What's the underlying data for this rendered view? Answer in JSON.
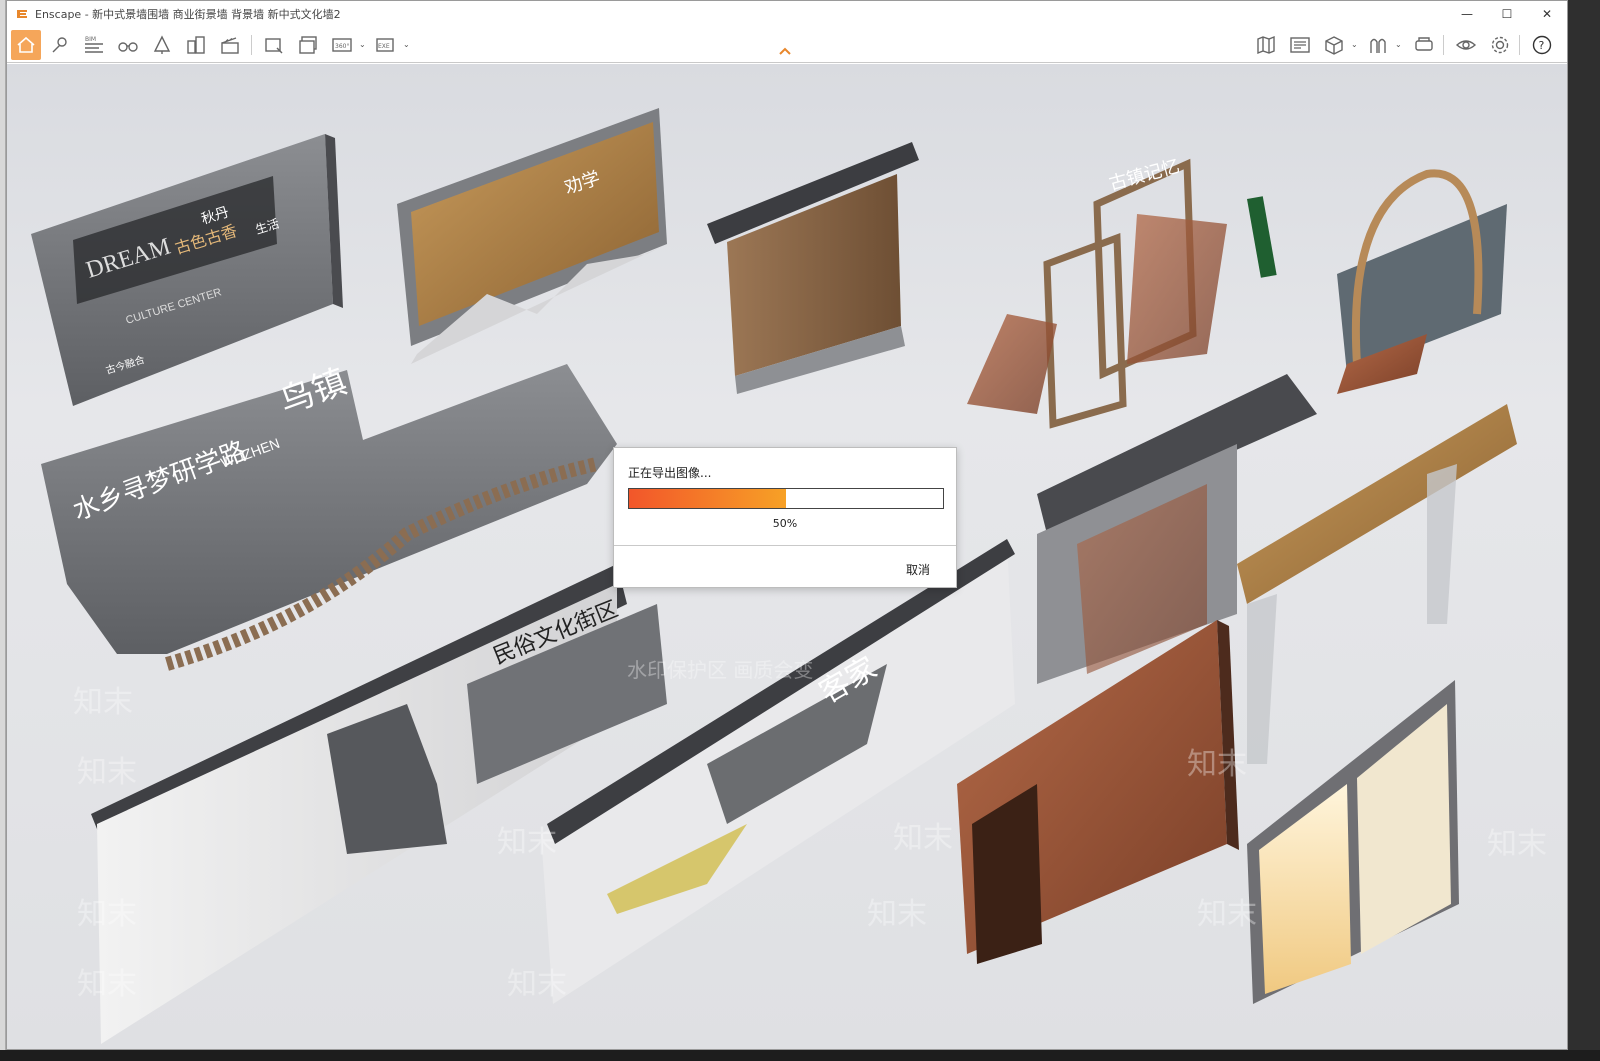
{
  "window": {
    "title": "Enscape - 新中式景墙围墙 商业街景墙 背景墙 新中式文化墙2",
    "controls": {
      "minimize": "—",
      "maximize": "☐",
      "close": "✕"
    }
  },
  "toolbar": {
    "left_tools": [
      "home-icon",
      "location-pin-icon",
      "bim-icon",
      "binoculars-icon",
      "tree-icon",
      "buildings-icon",
      "clapperboard-icon"
    ],
    "export_tools": [
      "screenshot-icon",
      "batch-render-icon",
      "panorama-icon",
      "exe-export-icon"
    ],
    "bim_label": "BIM",
    "panorama_label": "360°",
    "exe_label": "EXE",
    "right_tools": [
      "map-icon",
      "render-window-icon",
      "cube-icon",
      "atlas-icon",
      "vr-headset-icon",
      "eye-icon",
      "gear-icon",
      "help-icon"
    ],
    "help_label": "?"
  },
  "dialog": {
    "title": "正在导出图像...",
    "progress": 0.5,
    "progress_label": "50%",
    "cancel_label": "取消"
  },
  "colors": {
    "accent": "#f5a65a",
    "progress_start": "#f2562a",
    "progress_end": "#f7a126"
  },
  "viewport": {
    "texts": {
      "dream": "DREAM",
      "guse": "古色古香",
      "qiudan": "秋丹",
      "shenghuo": "生活",
      "culture": "CULTURE CENTER",
      "guchen": "古今融合",
      "quanjun": "劝学",
      "guzhen": "古镇记忆",
      "shuixiang": "水乡寻梦研学路",
      "wuzhen_cn": "鸟镇",
      "wuzhen_en": "WUZHEN",
      "minsu": "民俗文化街区",
      "kejia": "客家",
      "watermark_center": "水印保护区  画质会变",
      "watermark": "知末"
    }
  }
}
